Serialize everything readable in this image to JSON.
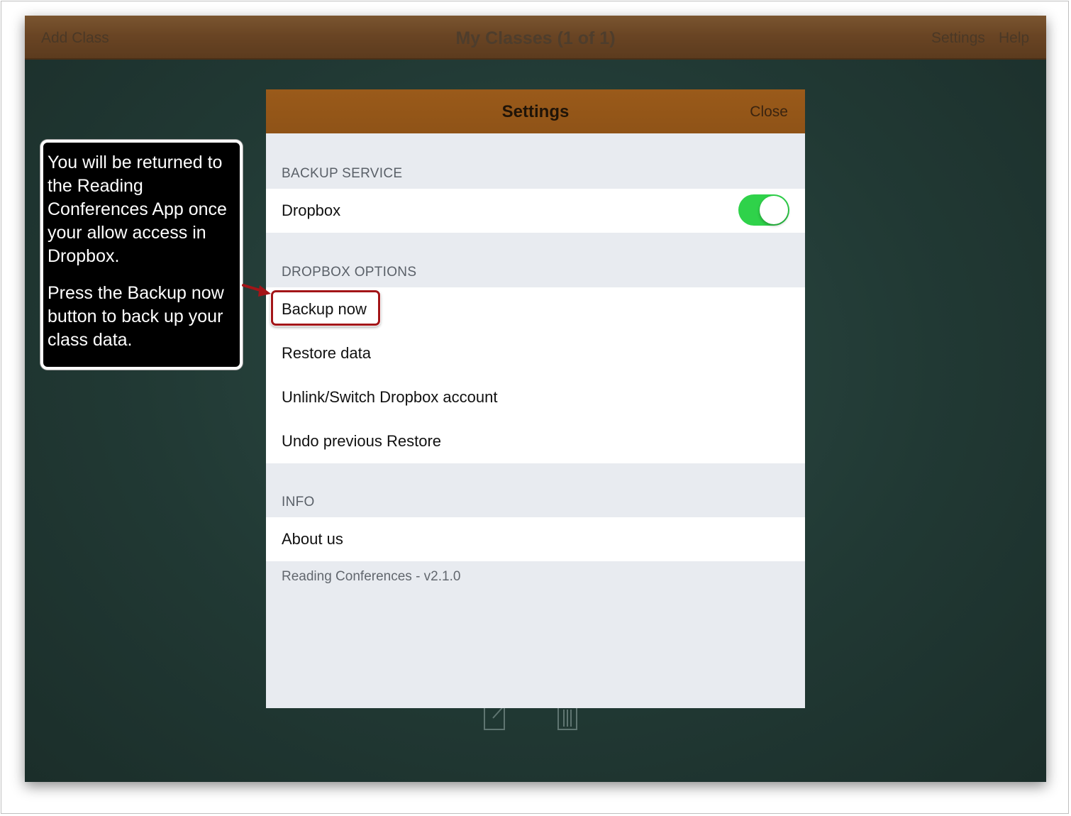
{
  "topbar": {
    "add_class": "Add Class",
    "title": "My Classes (1 of 1)",
    "settings": "Settings",
    "help": "Help"
  },
  "settings_modal": {
    "title": "Settings",
    "close": "Close",
    "backup_service": {
      "header": "BACKUP SERVICE",
      "dropbox_label": "Dropbox",
      "dropbox_enabled": true
    },
    "dropbox_options": {
      "header": "DROPBOX OPTIONS",
      "items": [
        "Backup now",
        "Restore data",
        "Unlink/Switch Dropbox account",
        "Undo previous Restore"
      ]
    },
    "info": {
      "header": "INFO",
      "about": "About us",
      "version": "Reading Conferences - v2.1.0"
    }
  },
  "callout": {
    "paragraph1": "You will be returned to the Reading Conferences App once your allow access in Dropbox.",
    "paragraph2": "Press the Backup now button to back up your class data."
  },
  "icons": [
    "edit-icon",
    "trash-icon",
    "arrow-icon"
  ],
  "colors": {
    "header_brown": "#8f5317",
    "toggle_green": "#2fd24a",
    "highlight_red": "#a31518",
    "chalkboard": "#213934"
  }
}
